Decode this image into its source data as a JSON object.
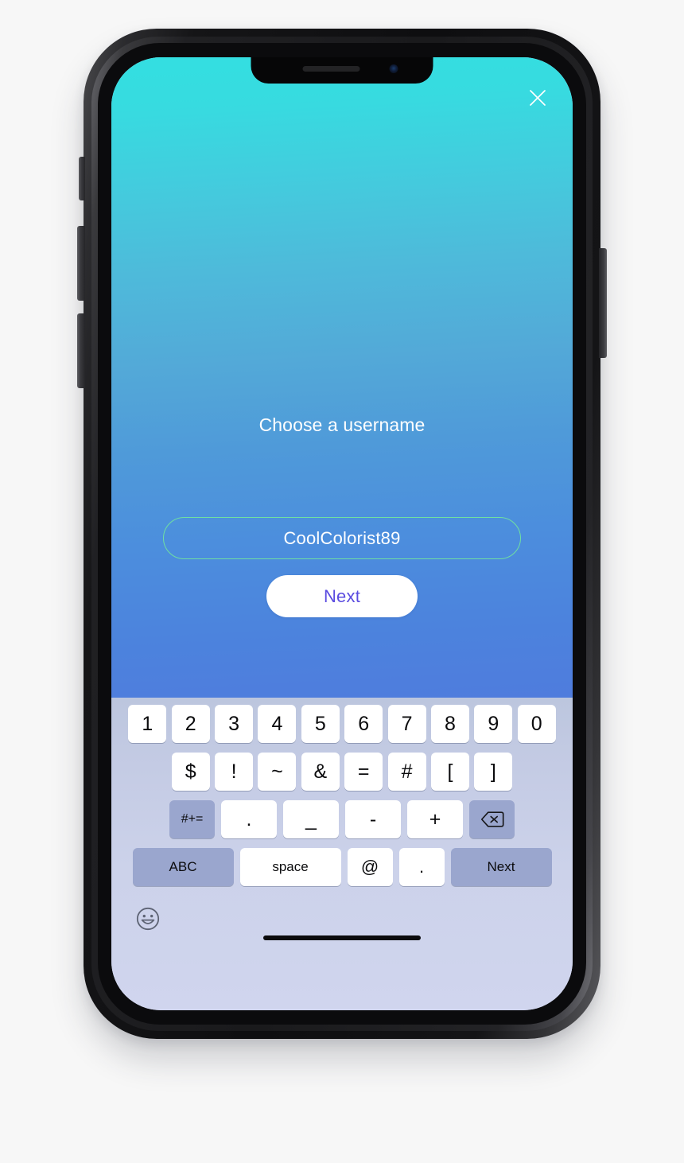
{
  "app": {
    "title": "Choose a username",
    "close_icon": "close-x-icon",
    "accent_border": "#6fdfa2",
    "gradient_top": "#33dfe1",
    "gradient_bottom": "#4f7cdd",
    "next_text_color": "#5b4ce0"
  },
  "username_input": {
    "value": "CoolColorist89",
    "placeholder": "Username"
  },
  "next_button": {
    "label": "Next"
  },
  "keyboard": {
    "row1": [
      "1",
      "2",
      "3",
      "4",
      "5",
      "6",
      "7",
      "8",
      "9",
      "0"
    ],
    "row2": [
      "$",
      "!",
      "~",
      "&",
      "=",
      "#",
      "[",
      "]"
    ],
    "row3": {
      "shift_label": "#+=",
      "chars": [
        ".",
        "_",
        "-",
        "+"
      ],
      "backspace_icon": "backspace-icon"
    },
    "row4": {
      "abc_label": "ABC",
      "space_label": "space",
      "at_label": "@",
      "period_label": ".",
      "next_label": "Next"
    },
    "emoji_icon": "emoji-smiley-icon",
    "key_bg_white": "#ffffff",
    "key_bg_dark": "#9aa6ce",
    "background_top": "#bcc6de",
    "background_bottom": "#d0d5ee"
  },
  "device": {
    "notch_icons": [
      "speaker-grill",
      "front-camera"
    ],
    "side_buttons": [
      "mute-switch",
      "volume-up",
      "volume-down",
      "power-button"
    ],
    "home_indicator": "home-indicator-bar"
  }
}
